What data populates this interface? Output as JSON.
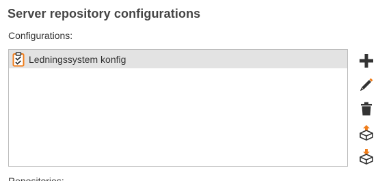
{
  "header": {
    "title": "Server repository configurations"
  },
  "configurations": {
    "label": "Configurations:",
    "items": [
      {
        "label": "Ledningssystem konfig",
        "icon": "clipboard-check-icon",
        "selected": true
      }
    ]
  },
  "repositories": {
    "label": "Repositories:"
  },
  "toolbar": {
    "buttons": [
      {
        "icon": "plus-icon"
      },
      {
        "icon": "pencil-icon"
      },
      {
        "icon": "trash-icon"
      },
      {
        "icon": "package-export-icon"
      },
      {
        "icon": "package-import-icon"
      }
    ]
  },
  "colors": {
    "accent": "#f07d1a",
    "icon_dark": "#333333",
    "selection": "#e3e3e3",
    "border": "#bdbdbd"
  }
}
